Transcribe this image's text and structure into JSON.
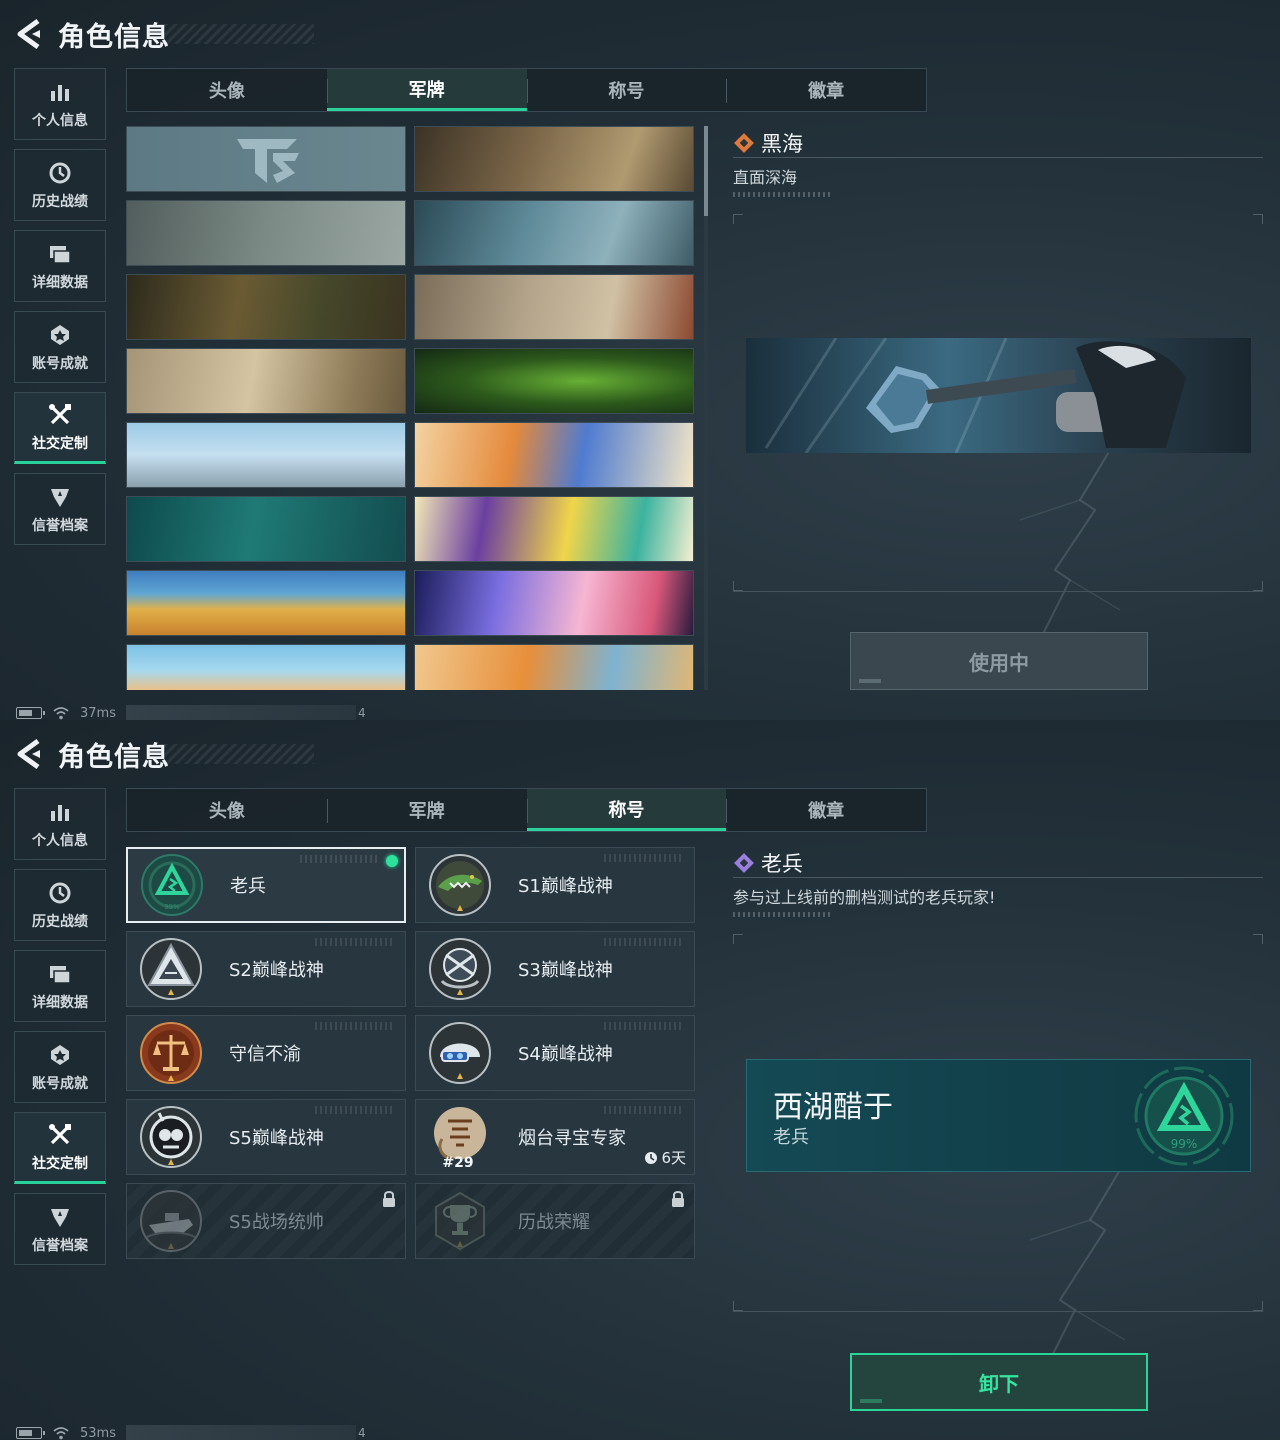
{
  "screens": [
    {
      "header": {
        "title": "角色信息"
      },
      "sidebar": [
        {
          "label": "个人信息",
          "icon": "bar-chart-icon"
        },
        {
          "label": "历史战绩",
          "icon": "history-clock-icon"
        },
        {
          "label": "详细数据",
          "icon": "folder-icon"
        },
        {
          "label": "账号成就",
          "icon": "achievement-icon"
        },
        {
          "label": "社交定制",
          "icon": "tools-icon",
          "active": true
        },
        {
          "label": "信誉档案",
          "icon": "reputation-icon"
        }
      ],
      "tabs": [
        {
          "label": "头像"
        },
        {
          "label": "军牌",
          "active": true
        },
        {
          "label": "称号"
        },
        {
          "label": "徽章"
        }
      ],
      "detail": {
        "name": "黑海",
        "description": "直面深海",
        "button_label": "使用中"
      },
      "status": {
        "latency": "37ms",
        "strip_value": "4"
      }
    },
    {
      "header": {
        "title": "角色信息"
      },
      "sidebar": [
        {
          "label": "个人信息",
          "icon": "bar-chart-icon"
        },
        {
          "label": "历史战绩",
          "icon": "history-clock-icon"
        },
        {
          "label": "详细数据",
          "icon": "folder-icon"
        },
        {
          "label": "账号成就",
          "icon": "achievement-icon"
        },
        {
          "label": "社交定制",
          "icon": "tools-icon",
          "active": true
        },
        {
          "label": "信誉档案",
          "icon": "reputation-icon"
        }
      ],
      "tabs": [
        {
          "label": "头像"
        },
        {
          "label": "军牌"
        },
        {
          "label": "称号",
          "active": true
        },
        {
          "label": "徽章"
        }
      ],
      "titles": [
        {
          "name": "老兵",
          "equipped": true,
          "selected": true,
          "badge_text": "99%"
        },
        {
          "name": "S1巅峰战神"
        },
        {
          "name": "S2巅峰战神"
        },
        {
          "name": "S3巅峰战神"
        },
        {
          "name": "守信不渝"
        },
        {
          "name": "S4巅峰战神"
        },
        {
          "name": "S5巅峰战神"
        },
        {
          "name": "烟台寻宝专家",
          "timer": "6天",
          "badge_text": "#29"
        },
        {
          "name": "S5战场统帅",
          "locked": true
        },
        {
          "name": "历战荣耀",
          "locked": true
        }
      ],
      "detail": {
        "name": "老兵",
        "description": "参与过上线前的删档测试的老兵玩家!",
        "banner_player": "西湖醋于",
        "banner_title": "老兵",
        "banner_badge": "99%",
        "button_label": "卸下"
      },
      "status": {
        "latency": "53ms",
        "strip_value": "4"
      }
    }
  ],
  "colors": {
    "accent_green": "#2ad29c",
    "background": "#23313a",
    "detail_diamond_orange": "#e07a3c",
    "detail_diamond_purple": "#9a7ee0"
  }
}
